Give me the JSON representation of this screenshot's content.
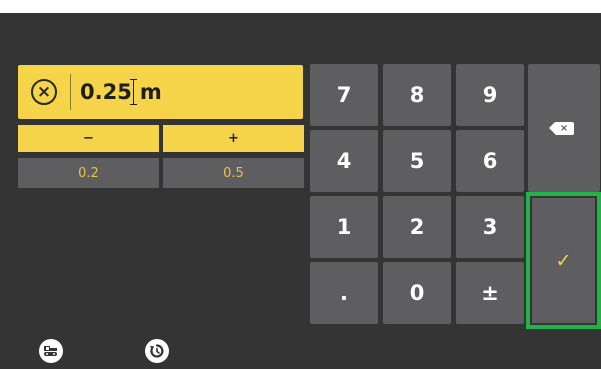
{
  "value_field": {
    "clear_icon_glyph": "×",
    "value": "0.25",
    "unit": "m"
  },
  "step_buttons": {
    "decrement": "−",
    "increment": "+"
  },
  "presets": [
    "0.2",
    "0.5"
  ],
  "keypad": {
    "row1": [
      "7",
      "8",
      "9"
    ],
    "row2": [
      "4",
      "5",
      "6"
    ],
    "row3": [
      "1",
      "2",
      "3"
    ],
    "row4": [
      ".",
      "0",
      "±"
    ],
    "backspace_glyph": "×",
    "confirm_glyph": "✓"
  },
  "icons": {
    "clear": "clear-circle-icon",
    "backspace": "backspace-icon",
    "confirm": "checkmark-icon",
    "machine": "excavator-icon",
    "reset": "reset-icon"
  },
  "colors": {
    "accent_yellow": "#f5d44a",
    "background": "#343434",
    "key_gray": "#5e5e60",
    "focus_green": "#21b34a"
  }
}
